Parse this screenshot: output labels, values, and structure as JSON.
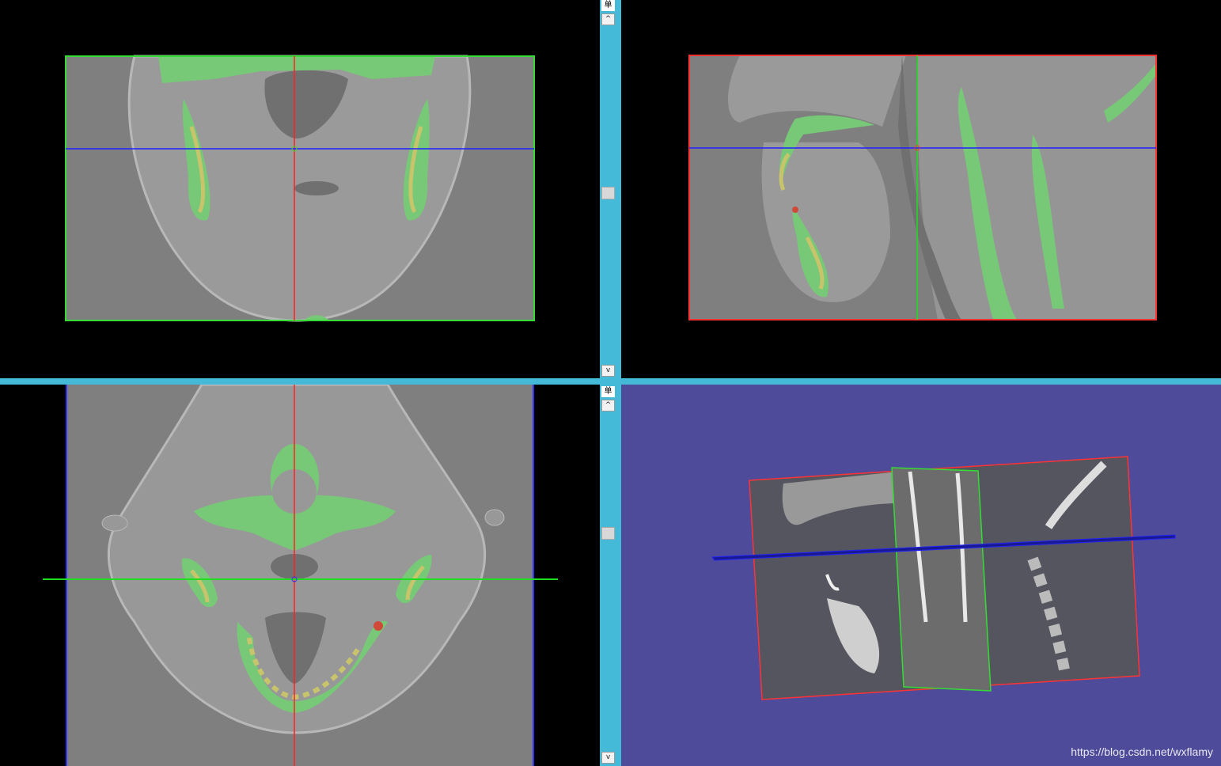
{
  "scrollbars": {
    "top": {
      "tag": "单",
      "up_glyph": "^",
      "down_glyph": "v"
    },
    "bottom": {
      "tag": "单",
      "up_glyph": "^",
      "down_glyph": "v"
    }
  },
  "views": {
    "coronal": {
      "frame_color": "#33dd33",
      "vline_color": "#ff2020",
      "hline_color": "#2020ff"
    },
    "sagittal": {
      "frame_color": "#ff3333",
      "vline_color": "#20dd20",
      "hline_color": "#2020ff"
    },
    "axial": {
      "frame_color": "#3030ff",
      "vline_color": "#ff2020",
      "hline_color": "#20dd20"
    },
    "render3d": {
      "background": "#4e4b9a"
    }
  },
  "colors": {
    "tissue_gray": "#7f7f7f",
    "segment_green": "#77c977",
    "segment_yellow": "#c8c46c",
    "segment_red": "#d04a3a"
  },
  "watermark": "https://blog.csdn.net/wxflamy"
}
